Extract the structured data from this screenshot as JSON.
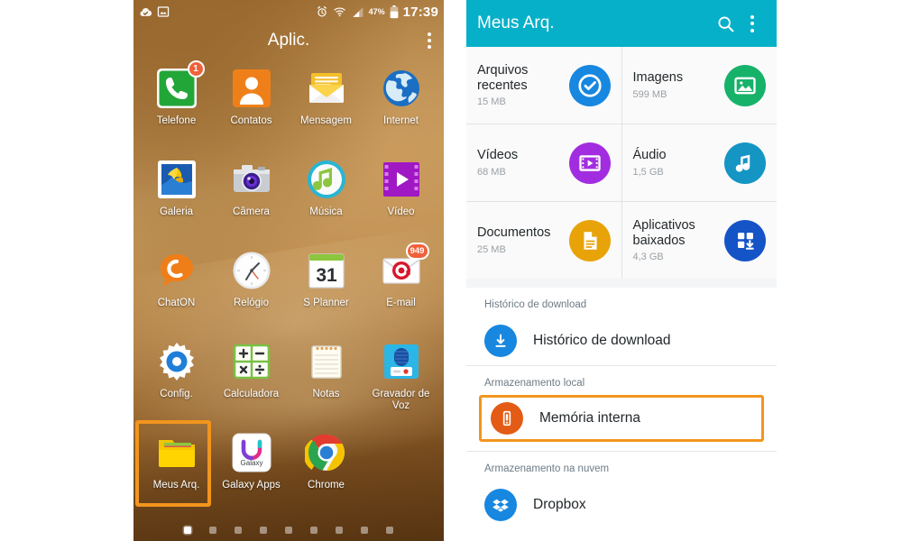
{
  "phone": {
    "status_bar": {
      "left_icons": [
        "cloud-check-icon",
        "screenshot-icon"
      ],
      "right_icons": [
        "alarm-icon",
        "wifi-icon",
        "signal-icon"
      ],
      "battery_percent": "47%",
      "clock": "17:39"
    },
    "action_bar": {
      "title": "Aplic.",
      "overflow": "overflow-menu-icon"
    },
    "apps": [
      {
        "label": "Telefone",
        "badge": "1",
        "icon": "phone-icon"
      },
      {
        "label": "Contatos",
        "badge": "",
        "icon": "contacts-icon"
      },
      {
        "label": "Mensagem",
        "badge": "",
        "icon": "message-icon"
      },
      {
        "label": "Internet",
        "badge": "",
        "icon": "internet-icon"
      },
      {
        "label": "Galeria",
        "badge": "",
        "icon": "gallery-icon"
      },
      {
        "label": "Câmera",
        "badge": "",
        "icon": "camera-icon"
      },
      {
        "label": "Música",
        "badge": "",
        "icon": "music-icon"
      },
      {
        "label": "Vídeo",
        "badge": "",
        "icon": "video-icon"
      },
      {
        "label": "ChatON",
        "badge": "",
        "icon": "chaton-icon"
      },
      {
        "label": "Relógio",
        "badge": "",
        "icon": "clock-icon"
      },
      {
        "label": "S Planner",
        "badge": "",
        "icon": "calendar-icon"
      },
      {
        "label": "E-mail",
        "badge": "949",
        "icon": "email-icon"
      },
      {
        "label": "Config.",
        "badge": "",
        "icon": "settings-gear-icon"
      },
      {
        "label": "Calculadora",
        "badge": "",
        "icon": "calculator-icon"
      },
      {
        "label": "Notas",
        "badge": "",
        "icon": "notes-icon"
      },
      {
        "label": "Gravador de Voz",
        "badge": "",
        "icon": "voice-recorder-icon"
      },
      {
        "label": "Meus Arq.",
        "badge": "",
        "icon": "folder-icon"
      },
      {
        "label": "Galaxy Apps",
        "badge": "",
        "icon": "galaxy-apps-icon"
      },
      {
        "label": "Chrome",
        "badge": "",
        "icon": "chrome-icon"
      }
    ],
    "page_dots": {
      "count": 9,
      "active_index": 0
    },
    "highlight": {
      "target": "Meus Arq.",
      "color": "#f2951d"
    }
  },
  "file_manager": {
    "header": {
      "title": "Meus Arq.",
      "search_icon": "search-icon",
      "overflow_icon": "overflow-menu-icon"
    },
    "categories": [
      {
        "title": "Arquivos recentes",
        "size": "15 MB",
        "icon": "recent-check-icon",
        "color": "#1787e0"
      },
      {
        "title": "Imagens",
        "size": "599 MB",
        "icon": "image-icon",
        "color": "#16b26a"
      },
      {
        "title": "Vídeos",
        "size": "68 MB",
        "icon": "video-film-icon",
        "color": "#a22de0"
      },
      {
        "title": "Áudio",
        "size": "1,5 GB",
        "icon": "music-note-icon",
        "color": "#1495c4"
      },
      {
        "title": "Documentos",
        "size": "25 MB",
        "icon": "document-icon",
        "color": "#e8a309"
      },
      {
        "title": "Aplicativos baixados",
        "size": "4,3 GB",
        "icon": "apps-download-icon",
        "color": "#1554c6"
      }
    ],
    "sections": [
      {
        "heading": "Histórico de download",
        "rows": [
          {
            "label": "Histórico de download",
            "icon": "download-icon",
            "color": "#1787e0",
            "highlighted": false
          }
        ]
      },
      {
        "heading": "Armazenamento local",
        "rows": [
          {
            "label": "Memória interna",
            "icon": "internal-memory-icon",
            "color": "#e35b15",
            "highlighted": true
          }
        ]
      },
      {
        "heading": "Armazenamento na nuvem",
        "rows": [
          {
            "label": "Dropbox",
            "icon": "dropbox-icon",
            "color": "#1787e0",
            "highlighted": false
          }
        ]
      }
    ],
    "accent_color": "#06b0c9",
    "highlight_color": "#f2951d"
  }
}
